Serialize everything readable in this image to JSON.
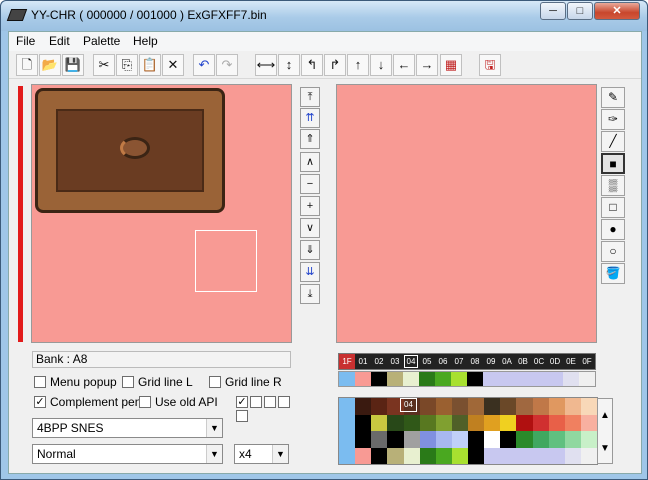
{
  "window": {
    "title": "YY-CHR ( 000000 / 001000 )  ExGFXFF7.bin",
    "min": "─",
    "max": "□",
    "close": "✕"
  },
  "menu": [
    "File",
    "Edit",
    "Palette",
    "Help"
  ],
  "toolbar": {
    "new": "🗋",
    "open": "📂",
    "save": "💾",
    "cut": "✂",
    "copy": "⎘",
    "paste": "📋",
    "delete": "✕",
    "undo": "↶",
    "redo": "↷",
    "flip_h": "⟷",
    "flip_v": "↕",
    "rot_left": "↰",
    "rot_right": "↱",
    "shift_up": "↑",
    "shift_down": "↓",
    "shift_left": "←",
    "shift_right": "→",
    "palette_tool": "▦",
    "export": "🖫"
  },
  "nav": [
    "⤒",
    "⇈",
    "⇑",
    "∧",
    "−",
    "+",
    "∨",
    "⇓",
    "⇊",
    "⤓"
  ],
  "tools": [
    "✎",
    "✑",
    "╱",
    "■",
    "▒",
    "□",
    "●",
    "○",
    "🪣"
  ],
  "bank": {
    "label": "Bank : A8"
  },
  "options": {
    "menu_popup": "Menu popup",
    "grid_line_l": "Grid line L",
    "grid_line_r": "Grid line R",
    "complement_pen": "Complement pen",
    "use_old_api": "Use old API",
    "check": "✓"
  },
  "format": {
    "value": "4BPP SNES",
    "arrow": "▼"
  },
  "mode": {
    "value": "Normal",
    "arrow": "▼"
  },
  "zoom": {
    "value": "x4",
    "arrow": "▼"
  },
  "palette_header": [
    "1F",
    "01",
    "02",
    "03",
    "04",
    "05",
    "06",
    "07",
    "08",
    "09",
    "0A",
    "0B",
    "0C",
    "0D",
    "0E",
    "0F"
  ],
  "palette_row": [
    "#7bbcf0",
    "#f89a94",
    "#000000",
    "#b8b078",
    "#e8f0d0",
    "#2a7a18",
    "#4aa820",
    "#a8e030",
    "#000000",
    "#c8c8f0",
    "#c8c8f0",
    "#c8c8f0",
    "#c8c8f0",
    "#c8c8f0",
    "#e0e0f0",
    "#f0f0f0"
  ],
  "palette_grid": [
    [
      "#7bbcf0",
      "#3a1a10",
      "#5a2414",
      "#7a3420",
      "#5a3020",
      "#7a4828",
      "#9a6030",
      "#7a5030",
      "#a06838",
      "#3a3020",
      "#6a4828",
      "#a06840",
      "#c07848",
      "#e09860",
      "#f0b890",
      "#f8d8b8"
    ],
    [
      "#7bbcf0",
      "#000000",
      "#c8c840",
      "#284818",
      "#305818",
      "#587820",
      "#80a030",
      "#506028",
      "#c08020",
      "#e0a020",
      "#f0d020",
      "#b01010",
      "#d03030",
      "#e86048",
      "#f08060",
      "#f8b0a0"
    ],
    [
      "#7bbcf0",
      "#000000",
      "#6a6a6a",
      "#000000",
      "#a0a0a0",
      "#8090e0",
      "#a8b8f0",
      "#c0d0f8",
      "#000000",
      "#ffffff",
      "#000000",
      "#2a8a2a",
      "#40a860",
      "#60c080",
      "#90d8a0",
      "#c8f0c8"
    ],
    [
      "#7bbcf0",
      "#f89a94",
      "#000000",
      "#b8b078",
      "#e8f0d0",
      "#2a7a18",
      "#4aa820",
      "#a8e030",
      "#000000",
      "#c8c8f0",
      "#c8c8f0",
      "#c8c8f0",
      "#c8c8f0",
      "#c8c8f0",
      "#e0e0f0",
      "#f0f0f0"
    ]
  ],
  "pal_label": "04",
  "spin": {
    "up": "▲",
    "down": "▼"
  }
}
